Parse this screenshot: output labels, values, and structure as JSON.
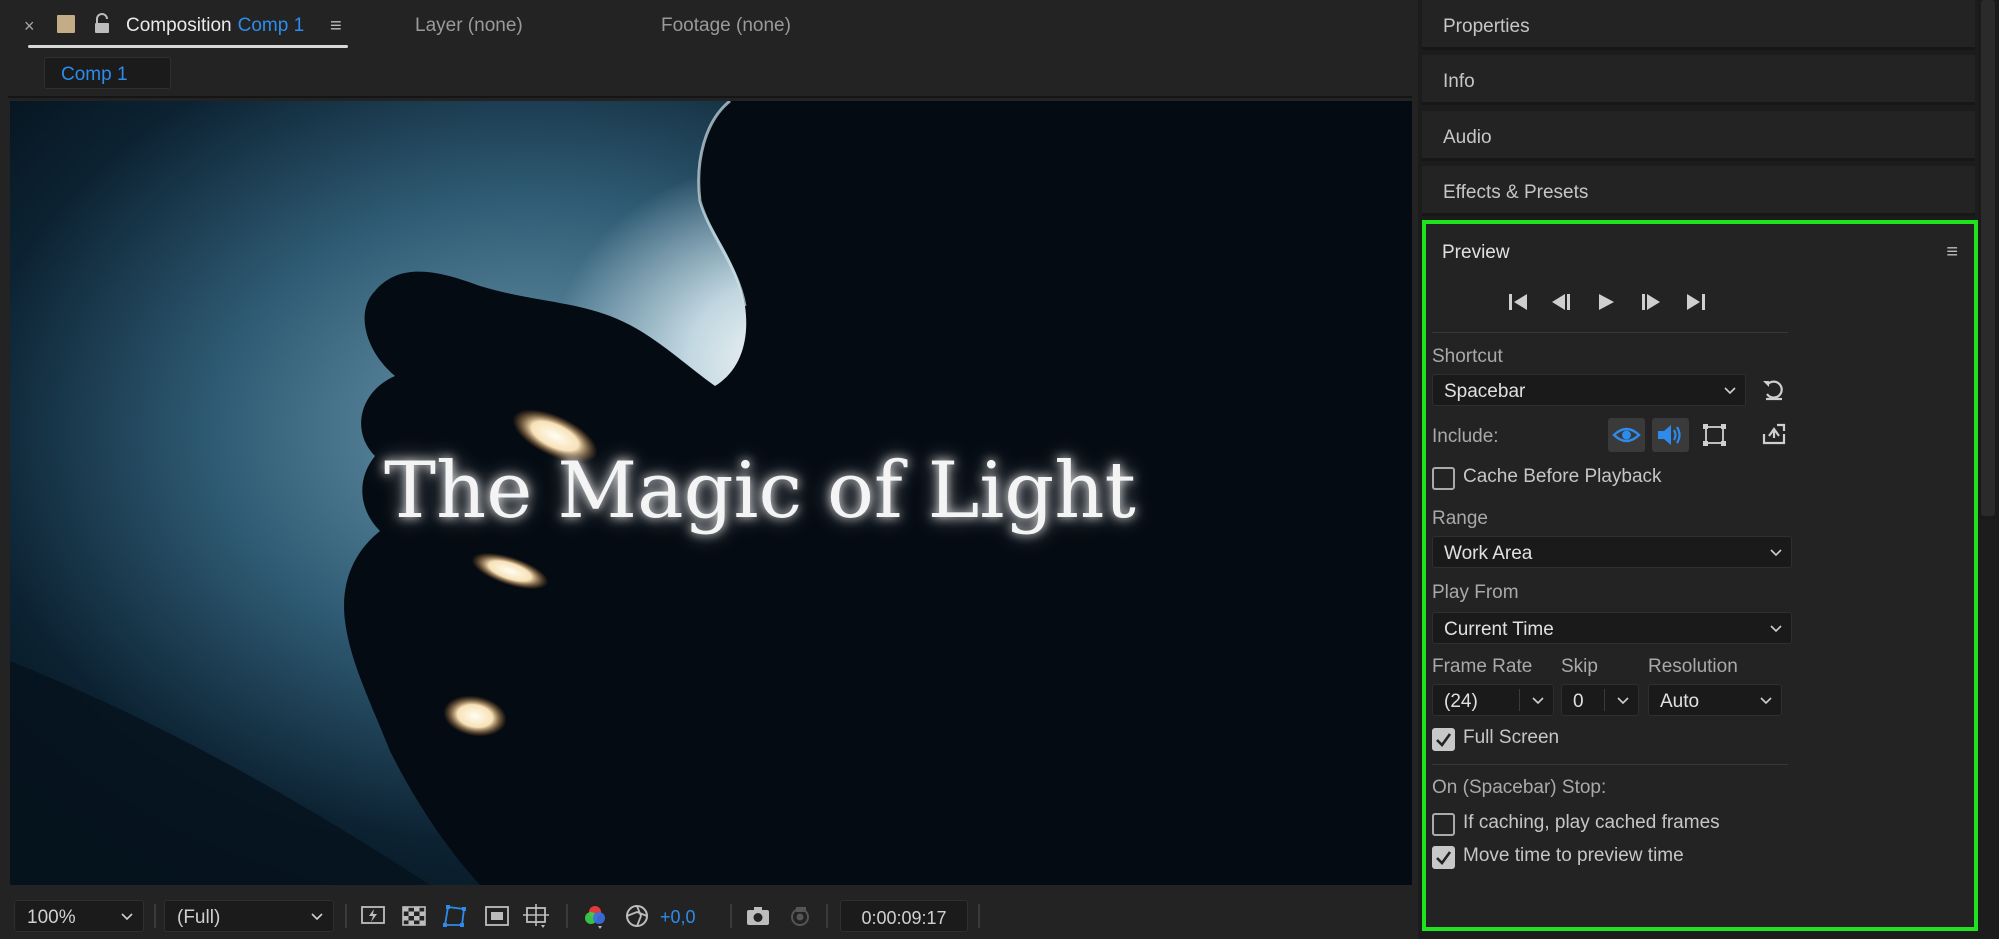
{
  "composition_tab": {
    "close": "×",
    "title_prefix": "Composition",
    "title_comp": "Comp 1",
    "menu": "≡",
    "layer_tab": "Layer (none)",
    "footage_tab": "Footage (none)"
  },
  "breadcrumb": {
    "comp": "Comp 1"
  },
  "viewer": {
    "title_text": "The Magic of Light"
  },
  "viewer_toolbar": {
    "zoom": "100%",
    "resolution": "(Full)",
    "exposure": "+0,0",
    "timecode": "0:00:09:17"
  },
  "right_panels": [
    "Properties",
    "Info",
    "Audio",
    "Effects & Presets"
  ],
  "preview": {
    "title": "Preview",
    "menu": "≡",
    "shortcut_label": "Shortcut",
    "shortcut_value": "Spacebar",
    "include_label": "Include:",
    "cache_before_playback": {
      "label": "Cache Before Playback",
      "checked": false
    },
    "range_label": "Range",
    "range_value": "Work Area",
    "play_from_label": "Play From",
    "play_from_value": "Current Time",
    "frame_rate_label": "Frame Rate",
    "frame_rate_value": "(24)",
    "skip_label": "Skip",
    "skip_value": "0",
    "resolution_label": "Resolution",
    "resolution_value": "Auto",
    "full_screen": {
      "label": "Full Screen",
      "checked": true
    },
    "stop_label": "On (Spacebar) Stop:",
    "if_caching": {
      "label": "If caching, play cached frames",
      "checked": false
    },
    "move_time": {
      "label": "Move time to preview time",
      "checked": true
    }
  },
  "colors": {
    "accent_blue": "#2d8ceb",
    "highlight_green": "#1ee31e",
    "panel_bg": "#232323"
  },
  "icons": [
    "close-icon",
    "lock-icon",
    "menu-icon",
    "first-frame-icon",
    "previous-frame-icon",
    "play-icon",
    "next-frame-icon",
    "last-frame-icon",
    "reset-icon",
    "eye-icon",
    "speaker-icon",
    "overlays-icon",
    "export-icon",
    "fast-previews-icon",
    "transparency-grid-icon",
    "mask-path-icon",
    "region-of-interest-icon",
    "guides-icon",
    "color-channels-icon",
    "exposure-reset-icon",
    "snapshot-icon",
    "show-snapshot-icon"
  ]
}
